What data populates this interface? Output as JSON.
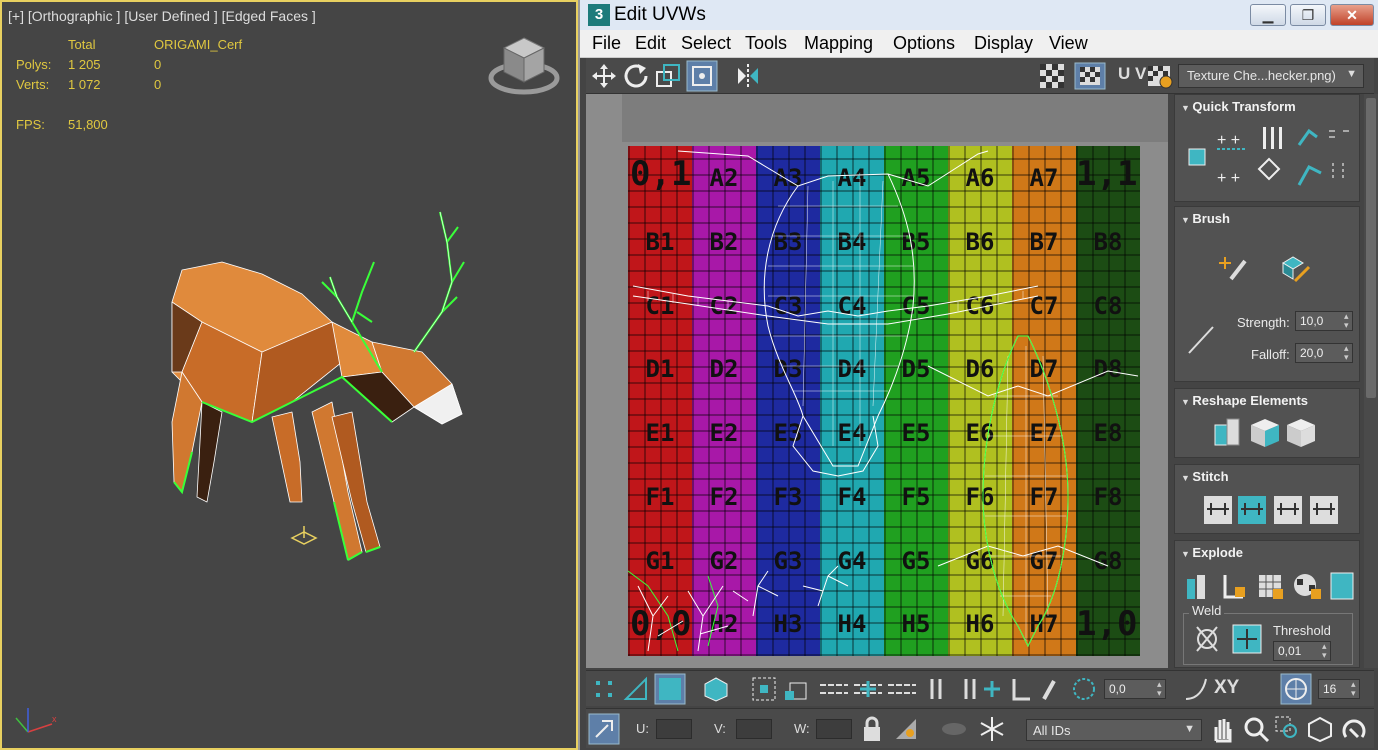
{
  "viewport": {
    "label": "[+] [Orthographic ] [User Defined ] [Edged Faces ]",
    "stats": {
      "col_total": "Total",
      "col_object": "ORIGAMI_Cerf",
      "polys_label": "Polys:",
      "polys_total": "1 205",
      "polys_obj": "0",
      "verts_label": "Verts:",
      "verts_total": "1 072",
      "verts_obj": "0",
      "fps_label": "FPS:",
      "fps_value": "51,800"
    },
    "icons": [
      "viewcube-icon",
      "axis-tripod-icon",
      "pivot-gizmo-icon"
    ]
  },
  "uvw": {
    "title": "Edit UVWs",
    "title_icon": "3",
    "window_buttons": {
      "minimize": "▁",
      "maximize": "❐",
      "close": "✕"
    },
    "menu": [
      "File",
      "Edit",
      "Select",
      "Tools",
      "Mapping",
      "Options",
      "Display",
      "View"
    ],
    "toolbar": {
      "uv_label": "U V",
      "texture_dropdown": "Texture Che...hecker.png)",
      "icons": [
        "move-icon",
        "rotate-icon",
        "scale-icon",
        "freeform-icon",
        "mirror-icon",
        "checker-icon",
        "checker-uv-icon",
        "settings-icon"
      ]
    },
    "checker": {
      "rows": [
        "A",
        "B",
        "C",
        "D",
        "E",
        "F",
        "G",
        "H"
      ],
      "cols": [
        "1",
        "2",
        "3",
        "4",
        "5",
        "6",
        "7",
        "8"
      ],
      "col_colors": [
        "#c0161a",
        "#a818a8",
        "#1e2aa0",
        "#20a8b0",
        "#20a020",
        "#b0c020",
        "#d07818",
        "#1c4c14"
      ],
      "corner_tl": "0,1",
      "corner_tr": "1,1",
      "corner_bl": "0,0",
      "corner_br": "1,0"
    },
    "panel": {
      "quick_transform": "Quick Transform",
      "brush": "Brush",
      "strength_label": "Strength:",
      "strength_value": "10,0",
      "falloff_label": "Falloff:",
      "falloff_value": "20,0",
      "reshape": "Reshape Elements",
      "stitch": "Stitch",
      "explode": "Explode",
      "weld_label": "Weld",
      "threshold_label": "Threshold",
      "threshold_value": "0,01"
    },
    "bottom": {
      "soft_value": "0,0",
      "xy_label": "XY",
      "grid_value": "16",
      "u_label": "U:",
      "v_label": "V:",
      "w_label": "W:",
      "id_dropdown": "All IDs"
    }
  },
  "colors": {
    "accent": "#3fb6c2",
    "viewport_bg": "#454545",
    "stat_text": "#e0c840",
    "deer_body": "#e08a3c",
    "selection": "#39ff39"
  }
}
